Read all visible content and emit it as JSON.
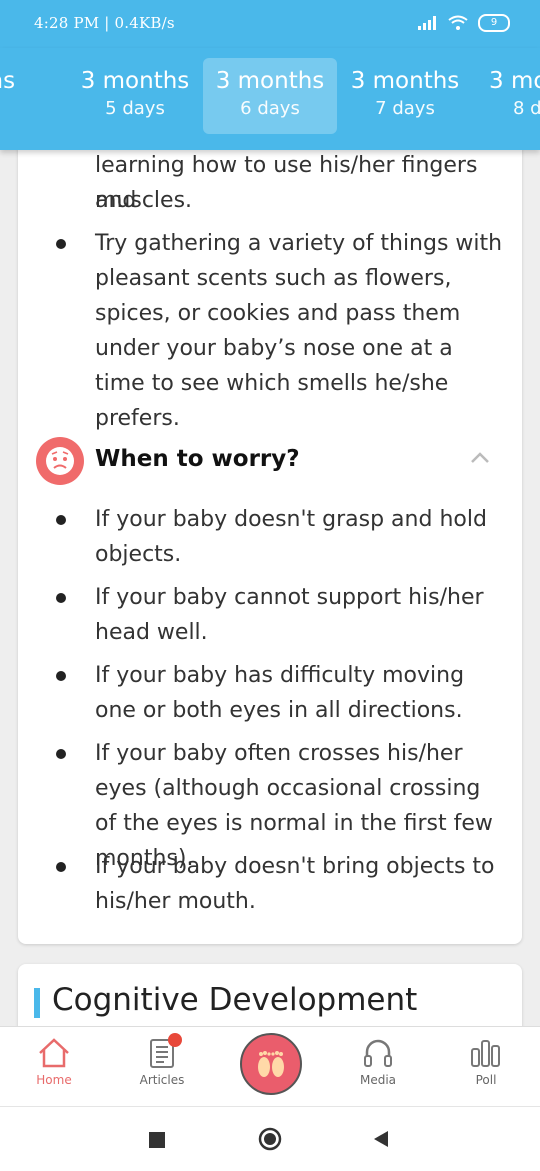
{
  "status_bar": {
    "text": "4:28 PM | 0.4KB/s",
    "battery": "9"
  },
  "tabs": [
    {
      "months": "onths",
      "days": "ays"
    },
    {
      "months": "3 months",
      "days": "5 days"
    },
    {
      "months": "3 months",
      "days": "6 days",
      "active": true
    },
    {
      "months": "3 months",
      "days": "7 days"
    },
    {
      "months": "3 mo",
      "days": "8 d"
    }
  ],
  "tips": {
    "partial_line_1": "learning how to use his/her fingers and",
    "partial_line_2": "muscles.",
    "items": [
      "Try gathering a variety of things with pleasant scents such as flowers, spices, or cookies and pass them under your baby’s nose one at a time to see which smells he/she prefers."
    ]
  },
  "worry": {
    "title": "When to worry?",
    "items": [
      "If your baby doesn't grasp and hold objects.",
      "If your baby cannot support his/her head well.",
      "If your baby has difficulty moving one or both eyes in all directions.",
      "If your baby often crosses his/her eyes (although occasional crossing of the eyes is normal in the first few months).",
      "If your baby doesn't bring objects to his/her mouth."
    ]
  },
  "next_section": {
    "title": "Cognitive Development"
  },
  "bottom_nav": {
    "home": "Home",
    "articles": "Articles",
    "media": "Media",
    "poll": "Poll"
  },
  "colors": {
    "accent": "#4ab8ea",
    "active_nav": "#e86b6b",
    "worry_icon": "#f06b6b"
  }
}
